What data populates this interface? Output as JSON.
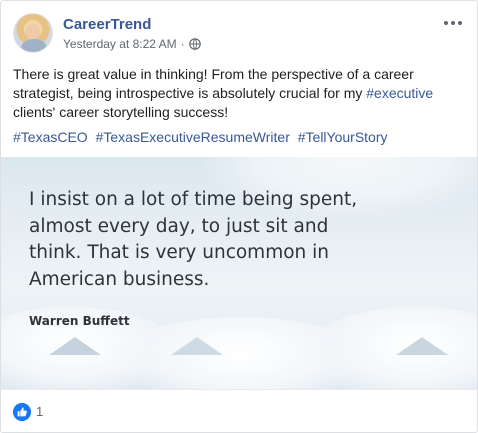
{
  "post": {
    "author": "CareerTrend",
    "timestamp": "Yesterday at 8:22 AM",
    "separator": "·",
    "privacy_icon": "globe-icon",
    "more_icon": "more-options-icon",
    "text_before": "There is great value in thinking! From the perspective of a career strategist, being introspective is absolutely crucial for my ",
    "text_link": "#executive",
    "text_after": " clients' career storytelling success!",
    "hashtags": [
      "#TexasCEO",
      "#TexasExecutiveResumeWriter",
      "#TellYourStory"
    ]
  },
  "image": {
    "quote": "I insist on a lot of time being spent, almost every day, to just sit and think. That is very uncommon in American business.",
    "attribution": "Warren Buffett"
  },
  "reactions": {
    "icon": "like-icon",
    "count": "1"
  },
  "colors": {
    "link": "#385898",
    "like": "#1877f2",
    "meta": "#606770"
  }
}
